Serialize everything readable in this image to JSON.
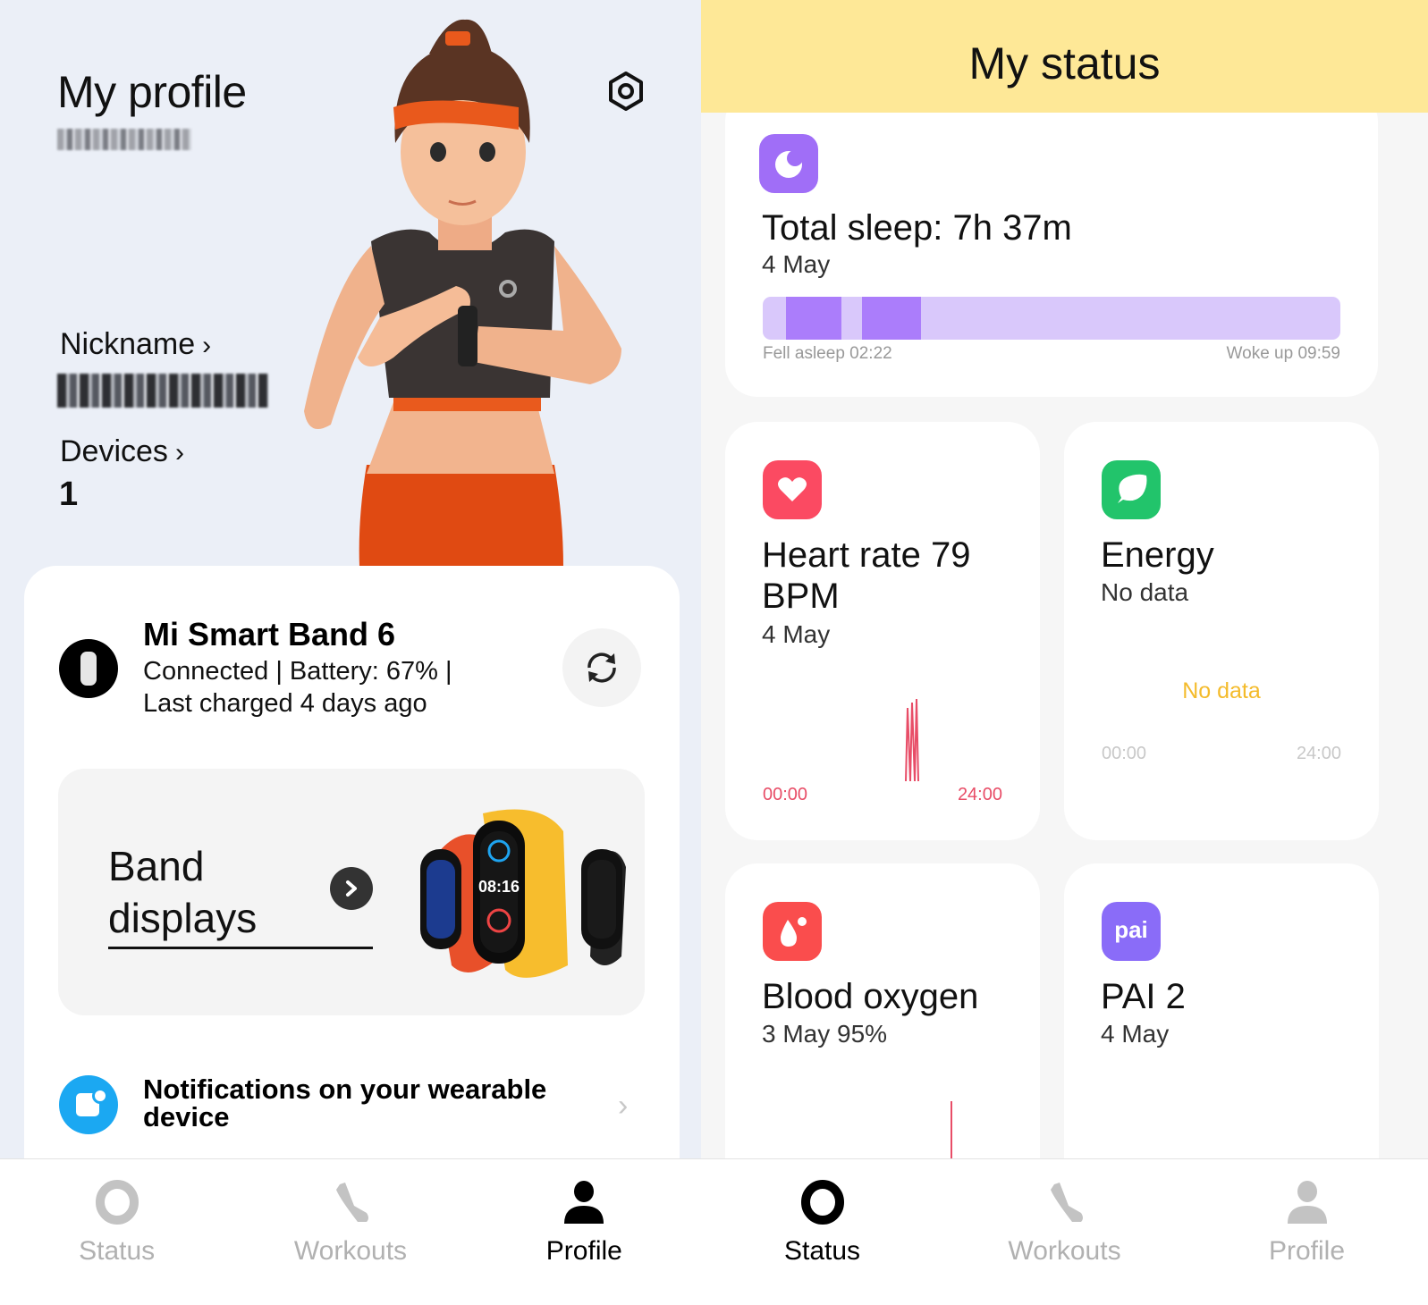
{
  "profile_screen": {
    "title": "My profile",
    "user_id_redacted": "",
    "settings_icon": "settings-hex-icon",
    "nickname_label": "Nickname",
    "nickname_value_redacted": "",
    "devices_label": "Devices",
    "devices_count": "1",
    "device_card": {
      "name": "Mi Smart Band 6",
      "status_line": "Connected | Battery: 67% |",
      "last_charged": "Last charged 4 days ago",
      "battery_percent": 67,
      "sync_icon": "sync-icon"
    },
    "band_displays": {
      "title_line1": "Band",
      "title_line2": "displays"
    },
    "notifications": {
      "label": "Notifications on your wearable device"
    },
    "tabs": [
      {
        "label": "Status",
        "icon": "status-ring-icon",
        "active": false
      },
      {
        "label": "Workouts",
        "icon": "shoe-icon",
        "active": false
      },
      {
        "label": "Profile",
        "icon": "person-icon",
        "active": true
      }
    ]
  },
  "status_screen": {
    "title": "My status",
    "colors": {
      "header": "#fee897",
      "sleep": "#a06ef7",
      "heart": "#fb4a62",
      "energy": "#22c46b",
      "oxygen": "#fa4d4d",
      "pai": "#8a6cf8",
      "no_data": "#f4bb2b"
    },
    "sleep": {
      "title": "Total sleep: 7h 37m",
      "date": "4 May",
      "fell_asleep": "Fell asleep 02:22",
      "woke_up": "Woke up 09:59",
      "deep_segments": [
        {
          "start_frac": 0.04,
          "end_frac": 0.137
        },
        {
          "start_frac": 0.172,
          "end_frac": 0.274
        }
      ]
    },
    "heart_rate": {
      "title": "Heart rate 79 BPM",
      "date": "4 May",
      "axis_start": "00:00",
      "axis_end": "24:00"
    },
    "energy": {
      "title": "Energy",
      "subtitle": "No data",
      "chart_message": "No data",
      "axis_start": "00:00",
      "axis_end": "24:00"
    },
    "blood_oxygen": {
      "title": "Blood oxygen",
      "subtitle": "3 May 95%"
    },
    "pai": {
      "title": "PAI 2",
      "subtitle": "4 May",
      "icon_text": "pai"
    },
    "tabs": [
      {
        "label": "Status",
        "icon": "status-ring-icon",
        "active": true
      },
      {
        "label": "Workouts",
        "icon": "shoe-icon",
        "active": false
      },
      {
        "label": "Profile",
        "icon": "person-icon",
        "active": false
      }
    ]
  }
}
